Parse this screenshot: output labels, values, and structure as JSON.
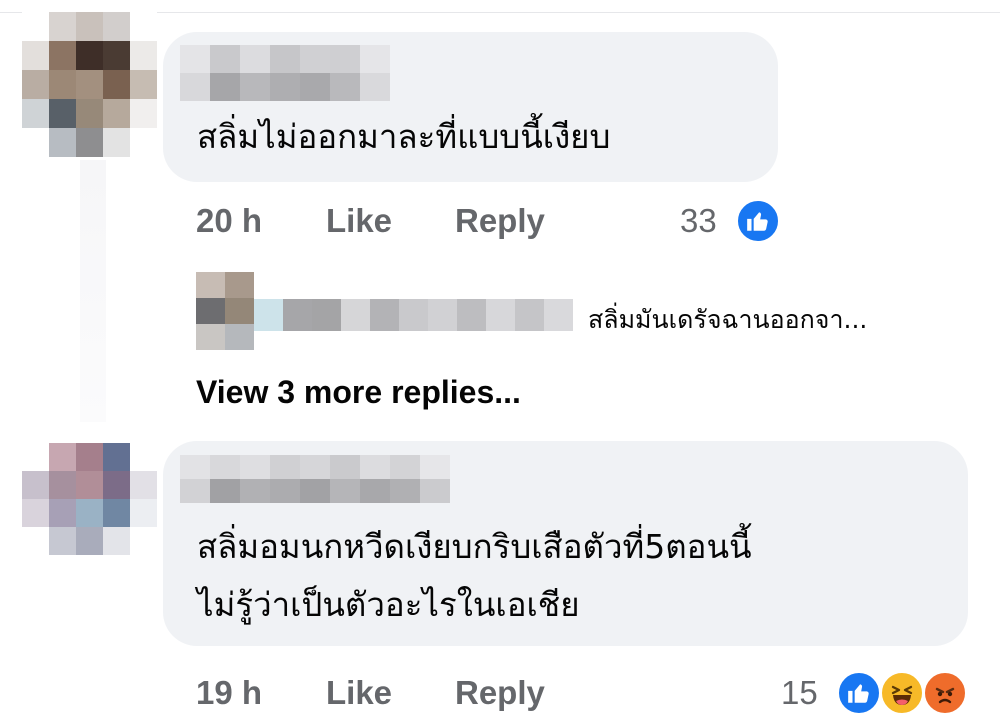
{
  "comments": [
    {
      "text": "สลิ่มไม่ออกมาละที่แบบนี้เงียบ",
      "time": "20 h",
      "like_label": "Like",
      "reply_label": "Reply",
      "reaction_count": "33",
      "reactions": [
        "like-icon"
      ]
    },
    {
      "text_line1": "สลิ่มอมนกหวีดเงียบกริบเสือตัวที่5ตอนนี้",
      "text_line2": "ไม่รู้ว่าเป็นตัวอะไรในเอเชีย",
      "time": "19 h",
      "like_label": "Like",
      "reply_label": "Reply",
      "reaction_count": "15",
      "reactions": [
        "like-icon",
        "haha-icon",
        "angry-icon"
      ]
    }
  ],
  "reply_preview": {
    "text": "สลิ่มมันเดรัจฉานออกจา..."
  },
  "view_more_label": "View 3 more replies...",
  "colors": {
    "bubble": "#f0f2f5",
    "meta": "#65676b",
    "like_blue": "#1877f2"
  }
}
